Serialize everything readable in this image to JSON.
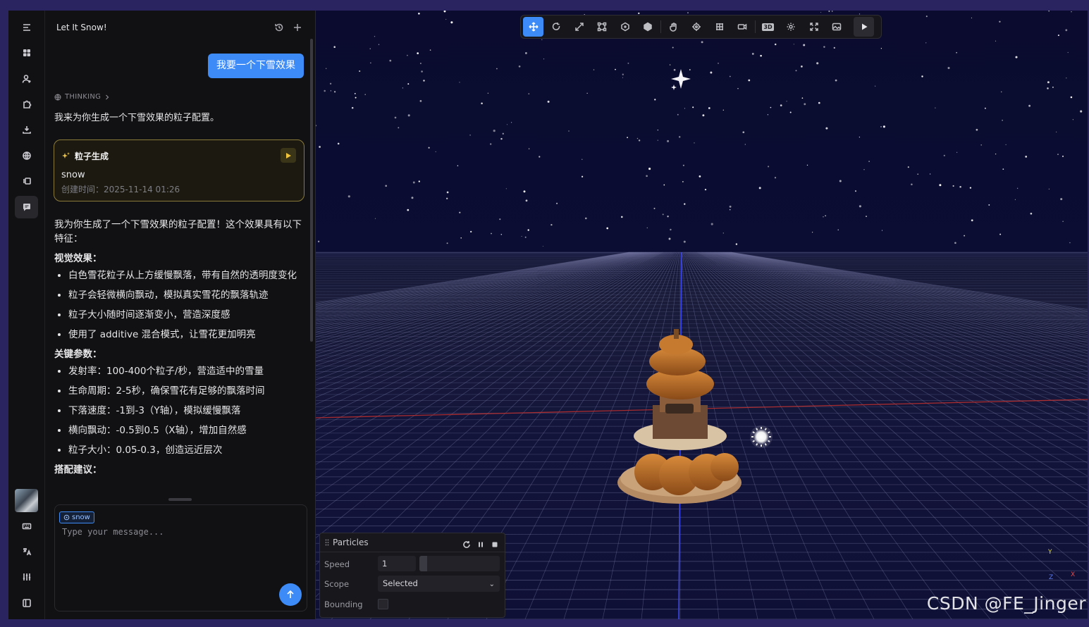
{
  "sidebar": {
    "icons": [
      "menu-icon",
      "grid-icon",
      "user-icon",
      "puzzle-icon",
      "download-icon",
      "globe-icon",
      "layers-icon",
      "chat-icon",
      "keyboard-icon",
      "translate-icon",
      "sliders-icon",
      "panel-icon"
    ],
    "active": "chat-icon"
  },
  "chat": {
    "title": "Let It Snow!",
    "user_message": "我要一个下雪效果",
    "thinking_label": "THINKING",
    "assistant_intro": "我来为你生成一个下雪效果的粒子配置。",
    "card": {
      "title": "粒子生成",
      "name": "snow",
      "created": "创建时间：2025-11-14 01:26"
    },
    "summary": "我为你生成了一个下雪效果的粒子配置！这个效果具有以下特征：",
    "visual_heading": "视觉效果：",
    "visual_items": [
      "白色雪花粒子从上方缓慢飘落，带有自然的透明度变化",
      "粒子会轻微横向飘动，模拟真实雪花的飘落轨迹",
      "粒子大小随时间逐渐变小，营造深度感",
      "使用了 additive 混合模式，让雪花更加明亮"
    ],
    "params_heading": "关键参数：",
    "params_items": [
      "发射率：100-400个粒子/秒，营造适中的雪量",
      "生命周期：2-5秒，确保雪花有足够的飘落时间",
      "下落速度：-1到-3（Y轴），模拟缓慢飘落",
      "横向飘动：-0.5到0.5（X轴），增加自然感",
      "粒子大小：0.05-0.3，创造远近层次"
    ],
    "suggest_heading": "搭配建议："
  },
  "composer": {
    "tag": "snow",
    "placeholder": "Type your message..."
  },
  "toolbar": {
    "tools": [
      "move-tool",
      "rotate-tool",
      "scale-tool",
      "rect-tool",
      "polygon-tool",
      "solid-tool",
      "pan-tool",
      "focus-tool",
      "grid-tool",
      "camera-tool",
      "3d-toggle",
      "settings-tool",
      "fullscreen-tool",
      "image-tool",
      "play-button"
    ],
    "active": "move-tool",
    "badge_3d": "3D"
  },
  "particles": {
    "title": "Particles",
    "speed_label": "Speed",
    "speed_value": "1",
    "speed_fraction": 0.1,
    "scope_label": "Scope",
    "scope_value": "Selected",
    "bounding_label": "Bounding",
    "bounding_checked": false
  },
  "axes": {
    "y": "Y",
    "z": "Z",
    "x": "X"
  },
  "watermark": "CSDN @FE_Jinger",
  "colors": {
    "accent": "#3d8bf7",
    "card_border": "#8a7a3a",
    "sky": "#0a0b2e"
  }
}
